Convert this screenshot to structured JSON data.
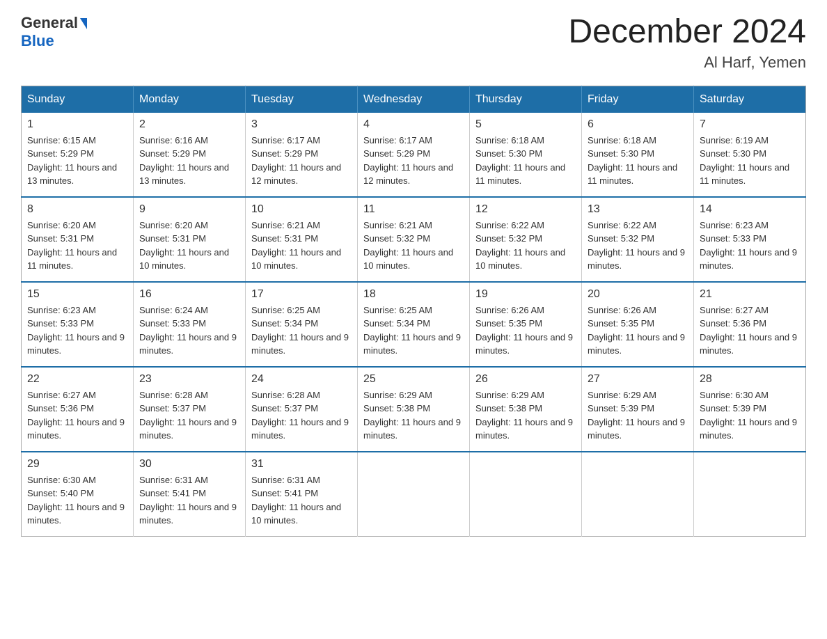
{
  "header": {
    "logo_general": "General",
    "logo_blue": "Blue",
    "month_title": "December 2024",
    "location": "Al Harf, Yemen"
  },
  "calendar": {
    "days_of_week": [
      "Sunday",
      "Monday",
      "Tuesday",
      "Wednesday",
      "Thursday",
      "Friday",
      "Saturday"
    ],
    "weeks": [
      [
        {
          "day": "1",
          "sunrise": "Sunrise: 6:15 AM",
          "sunset": "Sunset: 5:29 PM",
          "daylight": "Daylight: 11 hours and 13 minutes."
        },
        {
          "day": "2",
          "sunrise": "Sunrise: 6:16 AM",
          "sunset": "Sunset: 5:29 PM",
          "daylight": "Daylight: 11 hours and 13 minutes."
        },
        {
          "day": "3",
          "sunrise": "Sunrise: 6:17 AM",
          "sunset": "Sunset: 5:29 PM",
          "daylight": "Daylight: 11 hours and 12 minutes."
        },
        {
          "day": "4",
          "sunrise": "Sunrise: 6:17 AM",
          "sunset": "Sunset: 5:29 PM",
          "daylight": "Daylight: 11 hours and 12 minutes."
        },
        {
          "day": "5",
          "sunrise": "Sunrise: 6:18 AM",
          "sunset": "Sunset: 5:30 PM",
          "daylight": "Daylight: 11 hours and 11 minutes."
        },
        {
          "day": "6",
          "sunrise": "Sunrise: 6:18 AM",
          "sunset": "Sunset: 5:30 PM",
          "daylight": "Daylight: 11 hours and 11 minutes."
        },
        {
          "day": "7",
          "sunrise": "Sunrise: 6:19 AM",
          "sunset": "Sunset: 5:30 PM",
          "daylight": "Daylight: 11 hours and 11 minutes."
        }
      ],
      [
        {
          "day": "8",
          "sunrise": "Sunrise: 6:20 AM",
          "sunset": "Sunset: 5:31 PM",
          "daylight": "Daylight: 11 hours and 11 minutes."
        },
        {
          "day": "9",
          "sunrise": "Sunrise: 6:20 AM",
          "sunset": "Sunset: 5:31 PM",
          "daylight": "Daylight: 11 hours and 10 minutes."
        },
        {
          "day": "10",
          "sunrise": "Sunrise: 6:21 AM",
          "sunset": "Sunset: 5:31 PM",
          "daylight": "Daylight: 11 hours and 10 minutes."
        },
        {
          "day": "11",
          "sunrise": "Sunrise: 6:21 AM",
          "sunset": "Sunset: 5:32 PM",
          "daylight": "Daylight: 11 hours and 10 minutes."
        },
        {
          "day": "12",
          "sunrise": "Sunrise: 6:22 AM",
          "sunset": "Sunset: 5:32 PM",
          "daylight": "Daylight: 11 hours and 10 minutes."
        },
        {
          "day": "13",
          "sunrise": "Sunrise: 6:22 AM",
          "sunset": "Sunset: 5:32 PM",
          "daylight": "Daylight: 11 hours and 9 minutes."
        },
        {
          "day": "14",
          "sunrise": "Sunrise: 6:23 AM",
          "sunset": "Sunset: 5:33 PM",
          "daylight": "Daylight: 11 hours and 9 minutes."
        }
      ],
      [
        {
          "day": "15",
          "sunrise": "Sunrise: 6:23 AM",
          "sunset": "Sunset: 5:33 PM",
          "daylight": "Daylight: 11 hours and 9 minutes."
        },
        {
          "day": "16",
          "sunrise": "Sunrise: 6:24 AM",
          "sunset": "Sunset: 5:33 PM",
          "daylight": "Daylight: 11 hours and 9 minutes."
        },
        {
          "day": "17",
          "sunrise": "Sunrise: 6:25 AM",
          "sunset": "Sunset: 5:34 PM",
          "daylight": "Daylight: 11 hours and 9 minutes."
        },
        {
          "day": "18",
          "sunrise": "Sunrise: 6:25 AM",
          "sunset": "Sunset: 5:34 PM",
          "daylight": "Daylight: 11 hours and 9 minutes."
        },
        {
          "day": "19",
          "sunrise": "Sunrise: 6:26 AM",
          "sunset": "Sunset: 5:35 PM",
          "daylight": "Daylight: 11 hours and 9 minutes."
        },
        {
          "day": "20",
          "sunrise": "Sunrise: 6:26 AM",
          "sunset": "Sunset: 5:35 PM",
          "daylight": "Daylight: 11 hours and 9 minutes."
        },
        {
          "day": "21",
          "sunrise": "Sunrise: 6:27 AM",
          "sunset": "Sunset: 5:36 PM",
          "daylight": "Daylight: 11 hours and 9 minutes."
        }
      ],
      [
        {
          "day": "22",
          "sunrise": "Sunrise: 6:27 AM",
          "sunset": "Sunset: 5:36 PM",
          "daylight": "Daylight: 11 hours and 9 minutes."
        },
        {
          "day": "23",
          "sunrise": "Sunrise: 6:28 AM",
          "sunset": "Sunset: 5:37 PM",
          "daylight": "Daylight: 11 hours and 9 minutes."
        },
        {
          "day": "24",
          "sunrise": "Sunrise: 6:28 AM",
          "sunset": "Sunset: 5:37 PM",
          "daylight": "Daylight: 11 hours and 9 minutes."
        },
        {
          "day": "25",
          "sunrise": "Sunrise: 6:29 AM",
          "sunset": "Sunset: 5:38 PM",
          "daylight": "Daylight: 11 hours and 9 minutes."
        },
        {
          "day": "26",
          "sunrise": "Sunrise: 6:29 AM",
          "sunset": "Sunset: 5:38 PM",
          "daylight": "Daylight: 11 hours and 9 minutes."
        },
        {
          "day": "27",
          "sunrise": "Sunrise: 6:29 AM",
          "sunset": "Sunset: 5:39 PM",
          "daylight": "Daylight: 11 hours and 9 minutes."
        },
        {
          "day": "28",
          "sunrise": "Sunrise: 6:30 AM",
          "sunset": "Sunset: 5:39 PM",
          "daylight": "Daylight: 11 hours and 9 minutes."
        }
      ],
      [
        {
          "day": "29",
          "sunrise": "Sunrise: 6:30 AM",
          "sunset": "Sunset: 5:40 PM",
          "daylight": "Daylight: 11 hours and 9 minutes."
        },
        {
          "day": "30",
          "sunrise": "Sunrise: 6:31 AM",
          "sunset": "Sunset: 5:41 PM",
          "daylight": "Daylight: 11 hours and 9 minutes."
        },
        {
          "day": "31",
          "sunrise": "Sunrise: 6:31 AM",
          "sunset": "Sunset: 5:41 PM",
          "daylight": "Daylight: 11 hours and 10 minutes."
        },
        null,
        null,
        null,
        null
      ]
    ]
  }
}
